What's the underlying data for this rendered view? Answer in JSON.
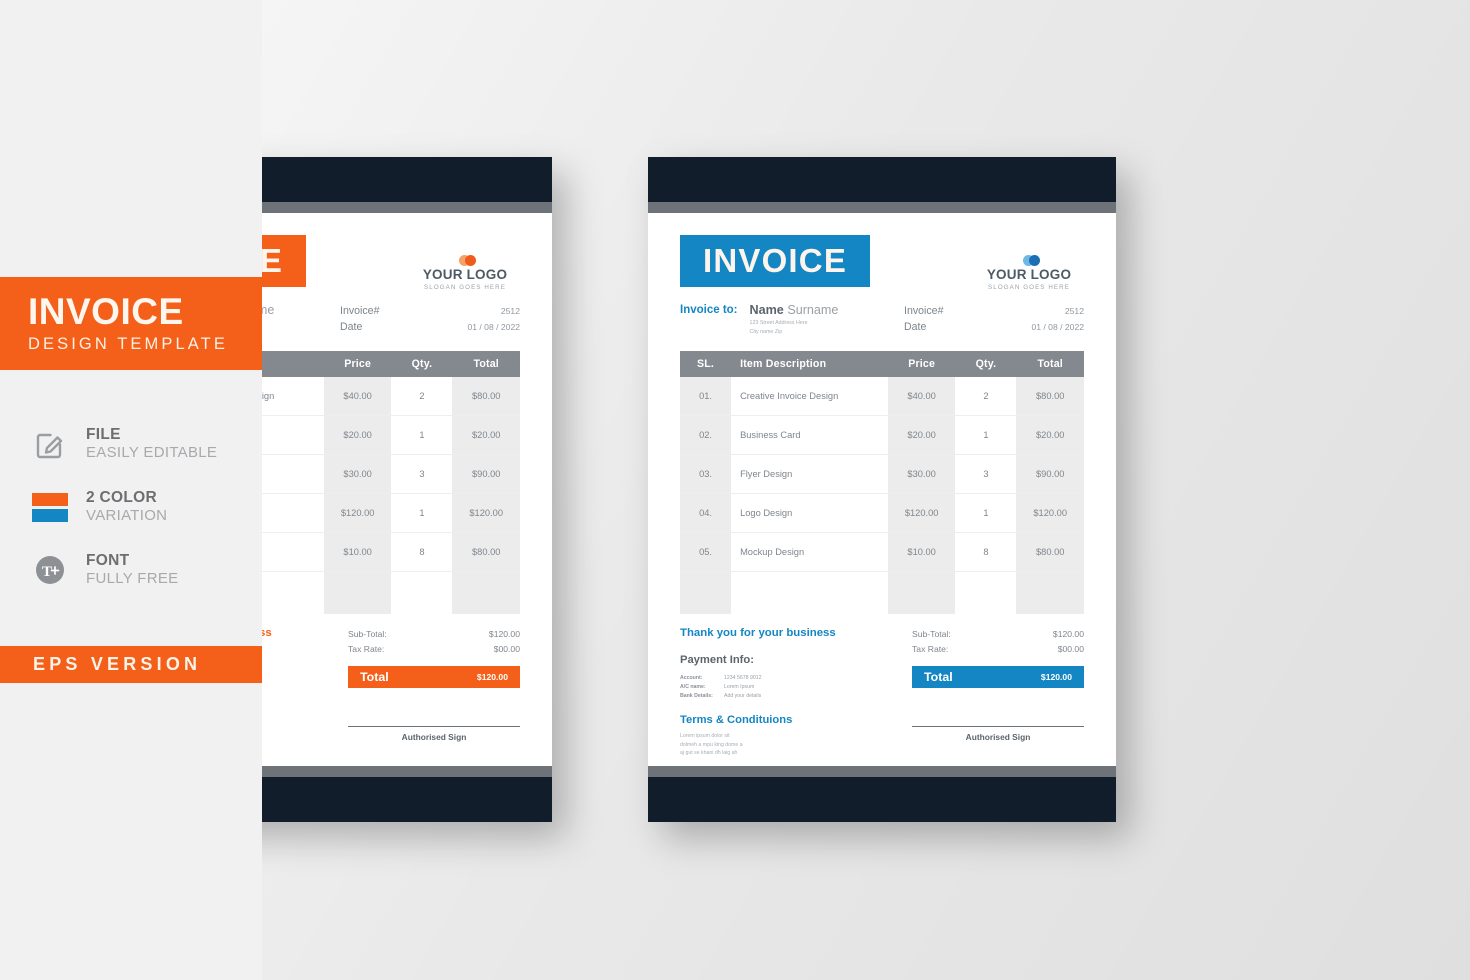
{
  "sidebar": {
    "title_main": "INVOICE",
    "title_sub": "DESIGN TEMPLATE",
    "features": [
      {
        "icon": "edit-file-icon",
        "title": "FILE",
        "sub": "EASILY EDITABLE"
      },
      {
        "icon": "color-swatch-icon",
        "title": "2 COLOR",
        "sub": "VARIATION"
      },
      {
        "icon": "font-icon",
        "title": "FONT",
        "sub": "FULLY FREE"
      }
    ],
    "eps_label": "EPS VERSION"
  },
  "colors": {
    "orange": "#f4601a",
    "blue": "#1486c4",
    "dark_navy": "#111d2b",
    "gray_bar": "#6e7379",
    "table_header": "#83898f",
    "stage_bg": "#e9e9e9",
    "sidebar_bg": "#f1f1f1"
  },
  "invoice": {
    "badge_title": "INVOICE",
    "logo": {
      "name": "YOUR LOGO",
      "slogan": "SLOGAN GOES HERE"
    },
    "bill_to_label": "Invoice to:",
    "bill_to_name_bold": "Name",
    "bill_to_name_rest": " Surname",
    "bill_to_address_1": "123 Street Address Here",
    "bill_to_address_2": "City name Zip",
    "meta": [
      {
        "key": "Invoice#",
        "value": "2512"
      },
      {
        "key": "Date",
        "value": "01 / 08 / 2022"
      }
    ],
    "table": {
      "headers": [
        "SL.",
        "Item Description",
        "Price",
        "Qty.",
        "Total"
      ],
      "rows": [
        {
          "sl": "01.",
          "desc": "Creative Invoice Design",
          "price": "$40.00",
          "qty": "2",
          "total": "$80.00"
        },
        {
          "sl": "02.",
          "desc": "Business Card",
          "price": "$20.00",
          "qty": "1",
          "total": "$20.00"
        },
        {
          "sl": "03.",
          "desc": "Flyer Design",
          "price": "$30.00",
          "qty": "3",
          "total": "$90.00"
        },
        {
          "sl": "04.",
          "desc": "Logo Design",
          "price": "$120.00",
          "qty": "1",
          "total": "$120.00"
        },
        {
          "sl": "05.",
          "desc": "Mockup Design",
          "price": "$10.00",
          "qty": "8",
          "total": "$80.00"
        }
      ]
    },
    "thanks": "Thank you for your business",
    "payment_title": "Payment Info:",
    "payment_rows": [
      {
        "key": "Account:",
        "value": "1234 5678 9012"
      },
      {
        "key": "A/C name:",
        "value": "Lorem Ipsum"
      },
      {
        "key": "Bank Details:",
        "value": "Add your details"
      }
    ],
    "terms_title": "Terms & Condituions",
    "terms_body_1": "Lorem ipsum dolor sit",
    "terms_body_2": "dolmeh a mpu king dome a",
    "terms_body_3": "aj gut se khani dh laig ah",
    "totals": [
      {
        "key": "Sub-Total:",
        "value": "$120.00"
      },
      {
        "key": "Tax Rate:",
        "value": "$00.00"
      }
    ],
    "total_label": "Total",
    "total_value": "$120.00",
    "sign_label": "Authorised Sign"
  }
}
